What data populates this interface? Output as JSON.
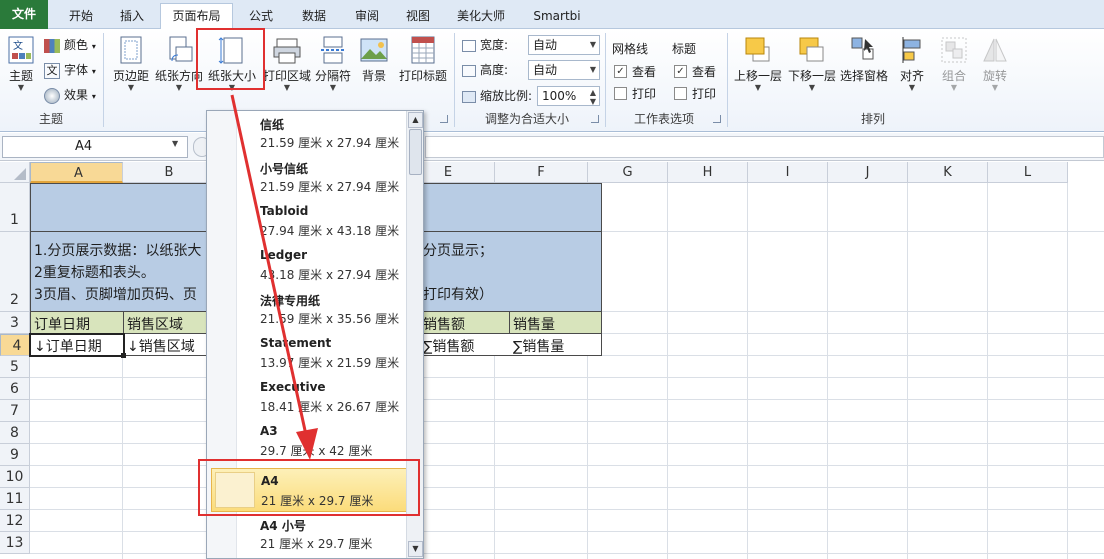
{
  "tabs": [
    "文件",
    "开始",
    "插入",
    "页面布局",
    "公式",
    "数据",
    "审阅",
    "视图",
    "美化大师",
    "Smartbi"
  ],
  "theme_group": {
    "label": "主题",
    "big_button": "主题",
    "items": [
      "颜色",
      "字体",
      "效果"
    ]
  },
  "page_setup_group": {
    "buttons": [
      "页边距",
      "纸张方向",
      "纸张大小",
      "打印区域",
      "分隔符",
      "背景",
      "打印标题"
    ]
  },
  "scale_group": {
    "label": "调整为合适大小",
    "width_label": "宽度:",
    "width_value": "自动",
    "height_label": "高度:",
    "height_value": "自动",
    "scale_label": "缩放比例:",
    "scale_value": "100%"
  },
  "sheet_options_group": {
    "label": "工作表选项",
    "gridlines": "网格线",
    "headings": "标题",
    "view": "查看",
    "print": "打印"
  },
  "arrange_group": {
    "label": "排列",
    "buttons": [
      "上移一层",
      "下移一层",
      "选择窗格",
      "对齐",
      "组合",
      "旋转"
    ]
  },
  "name_box": {
    "value": "A4"
  },
  "columns": [
    "A",
    "B",
    "C",
    "D",
    "E",
    "F",
    "G",
    "H",
    "I",
    "J",
    "K",
    "L"
  ],
  "rows": [
    "1",
    "2",
    "3",
    "4",
    "5",
    "6",
    "7",
    "8",
    "9",
    "10",
    "11",
    "12",
    "13"
  ],
  "cells": {
    "r2_line1": "1.分页展示数据：以纸张大",
    "r2_line1_tail": "分页显示；",
    "r2_line2": "2重复标题和表头。",
    "r2_line3": "3页眉、页脚增加页码、页",
    "r2_line3_tail": "打印有效）",
    "a3": "订单日期",
    "b3": "销售区域",
    "e3": "销售额",
    "f3": "销售量",
    "a4": "↓订单日期",
    "b4": "↓销售区域",
    "e4": "∑销售额",
    "f4": "∑销售量"
  },
  "paper_sizes": [
    {
      "name": "信纸",
      "size": "21.59 厘米 x 27.94 厘米"
    },
    {
      "name": "小号信纸",
      "size": "21.59 厘米 x 27.94 厘米"
    },
    {
      "name": "Tabloid",
      "size": "27.94 厘米 x 43.18 厘米"
    },
    {
      "name": "Ledger",
      "size": "43.18 厘米 x 27.94 厘米"
    },
    {
      "name": "法律专用纸",
      "size": "21.59 厘米 x 35.56 厘米"
    },
    {
      "name": "Statement",
      "size": "13.97 厘米 x 21.59 厘米"
    },
    {
      "name": "Executive",
      "size": "18.41 厘米 x 26.67 厘米"
    },
    {
      "name": "A3",
      "size": "29.7 厘米 x 42 厘米"
    },
    {
      "name": "A4",
      "size": "21 厘米 x 29.7 厘米"
    },
    {
      "name": "A4 小号",
      "size": "21 厘米 x 29.7 厘米"
    }
  ],
  "colors": {
    "accent_red": "#e03030",
    "header_fill": "#b8cce4",
    "table_header_fill": "#d8e4bc",
    "selected_item": "#fbdc7b",
    "file_tab": "#2a7a3a"
  }
}
